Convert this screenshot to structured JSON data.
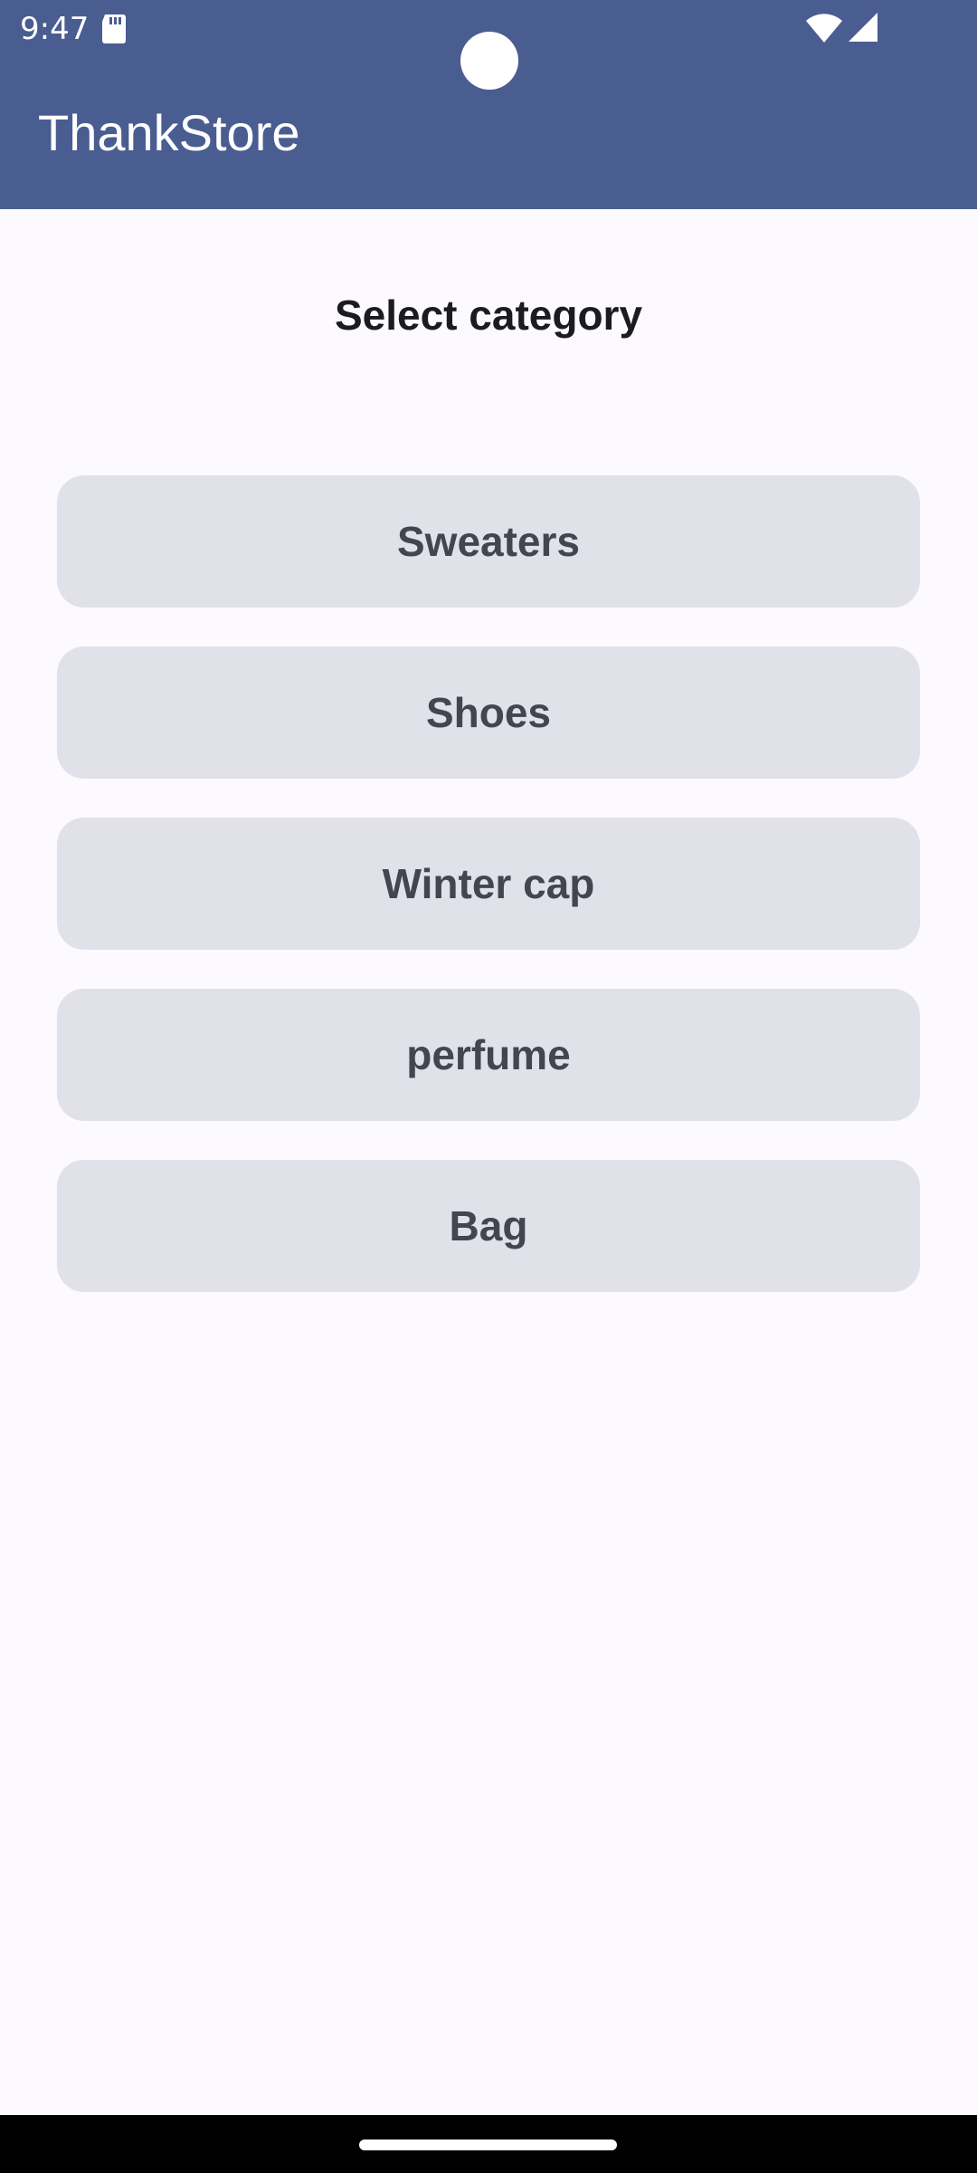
{
  "status_bar": {
    "time": "9:47",
    "icons": [
      "sd-card-icon",
      "wifi-icon",
      "cell-signal-icon"
    ]
  },
  "app_bar": {
    "title": "ThankStore",
    "color": "#4a5d91"
  },
  "main": {
    "heading": "Select category",
    "categories": [
      {
        "label": "Sweaters"
      },
      {
        "label": "Shoes"
      },
      {
        "label": "Winter cap"
      },
      {
        "label": "perfume"
      },
      {
        "label": "Bag"
      }
    ]
  },
  "theme": {
    "background": "#fcfaff",
    "button_background": "#e1e1ea",
    "button_text": "#44454f"
  }
}
